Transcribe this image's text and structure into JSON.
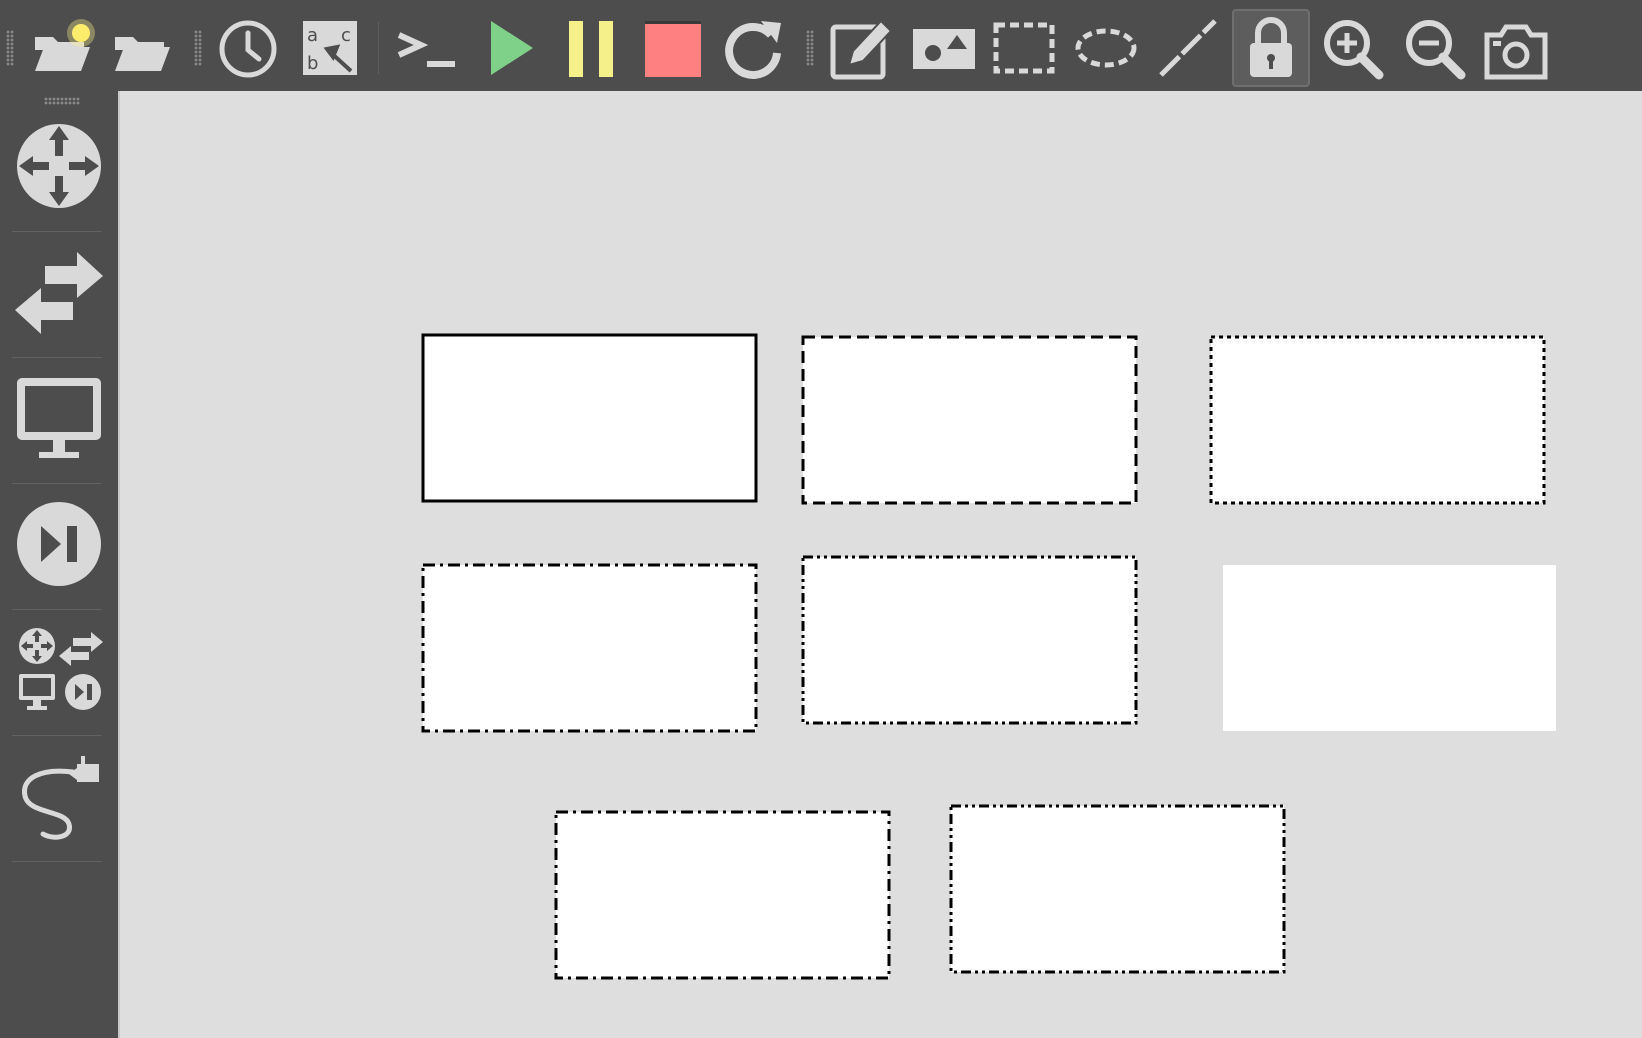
{
  "toolbar": {
    "items": [
      {
        "name": "new-project-icon",
        "tooltip": ""
      },
      {
        "name": "open-project-icon",
        "tooltip": ""
      },
      {
        "name": "snapshot-history-icon",
        "tooltip": ""
      },
      {
        "name": "show-labels-icon",
        "tooltip": ""
      },
      {
        "name": "console-icon",
        "tooltip": ""
      },
      {
        "name": "start-all-icon",
        "tooltip": ""
      },
      {
        "name": "suspend-all-icon",
        "tooltip": ""
      },
      {
        "name": "stop-all-icon",
        "tooltip": ""
      },
      {
        "name": "reload-all-icon",
        "tooltip": ""
      },
      {
        "name": "add-note-icon",
        "tooltip": ""
      },
      {
        "name": "insert-image-icon",
        "tooltip": ""
      },
      {
        "name": "draw-rectangle-icon",
        "tooltip": ""
      },
      {
        "name": "draw-ellipse-icon",
        "tooltip": ""
      },
      {
        "name": "draw-line-icon",
        "tooltip": ""
      },
      {
        "name": "lock-unlock-icon",
        "tooltip": ""
      },
      {
        "name": "zoom-in-icon",
        "tooltip": ""
      },
      {
        "name": "zoom-out-icon",
        "tooltip": ""
      },
      {
        "name": "screenshot-icon",
        "tooltip": ""
      }
    ],
    "active_item": "lock-unlock-icon"
  },
  "sidebar": {
    "items": [
      {
        "name": "routers-icon"
      },
      {
        "name": "switches-icon"
      },
      {
        "name": "end-devices-icon"
      },
      {
        "name": "security-devices-icon"
      },
      {
        "name": "all-devices-icon"
      },
      {
        "name": "add-link-icon"
      }
    ]
  },
  "colors": {
    "chrome": "#4d4d4d",
    "scene_bg": "#dedede",
    "icon_light": "#d9d9d9",
    "start": "#7fd18a",
    "suspend": "#f5f08a",
    "stop": "#ff8080",
    "shape_fill": "#ffffff",
    "shape_stroke": "#000000"
  },
  "scene": {
    "rectangles": [
      {
        "name": "rectangle-solid",
        "border_style": "solid"
      },
      {
        "name": "rectangle-dash",
        "border_style": "dash"
      },
      {
        "name": "rectangle-dot",
        "border_style": "dot"
      },
      {
        "name": "rectangle-dash-dot",
        "border_style": "dash-dot"
      },
      {
        "name": "rectangle-dash-dot-dot",
        "border_style": "dash-dot-dot"
      },
      {
        "name": "rectangle-no-border",
        "border_style": "none"
      },
      {
        "name": "rectangle-dash-dot-2",
        "border_style": "dash-dot"
      },
      {
        "name": "rectangle-dash-dot-dot-2",
        "border_style": "dash-dot-dot"
      }
    ]
  }
}
